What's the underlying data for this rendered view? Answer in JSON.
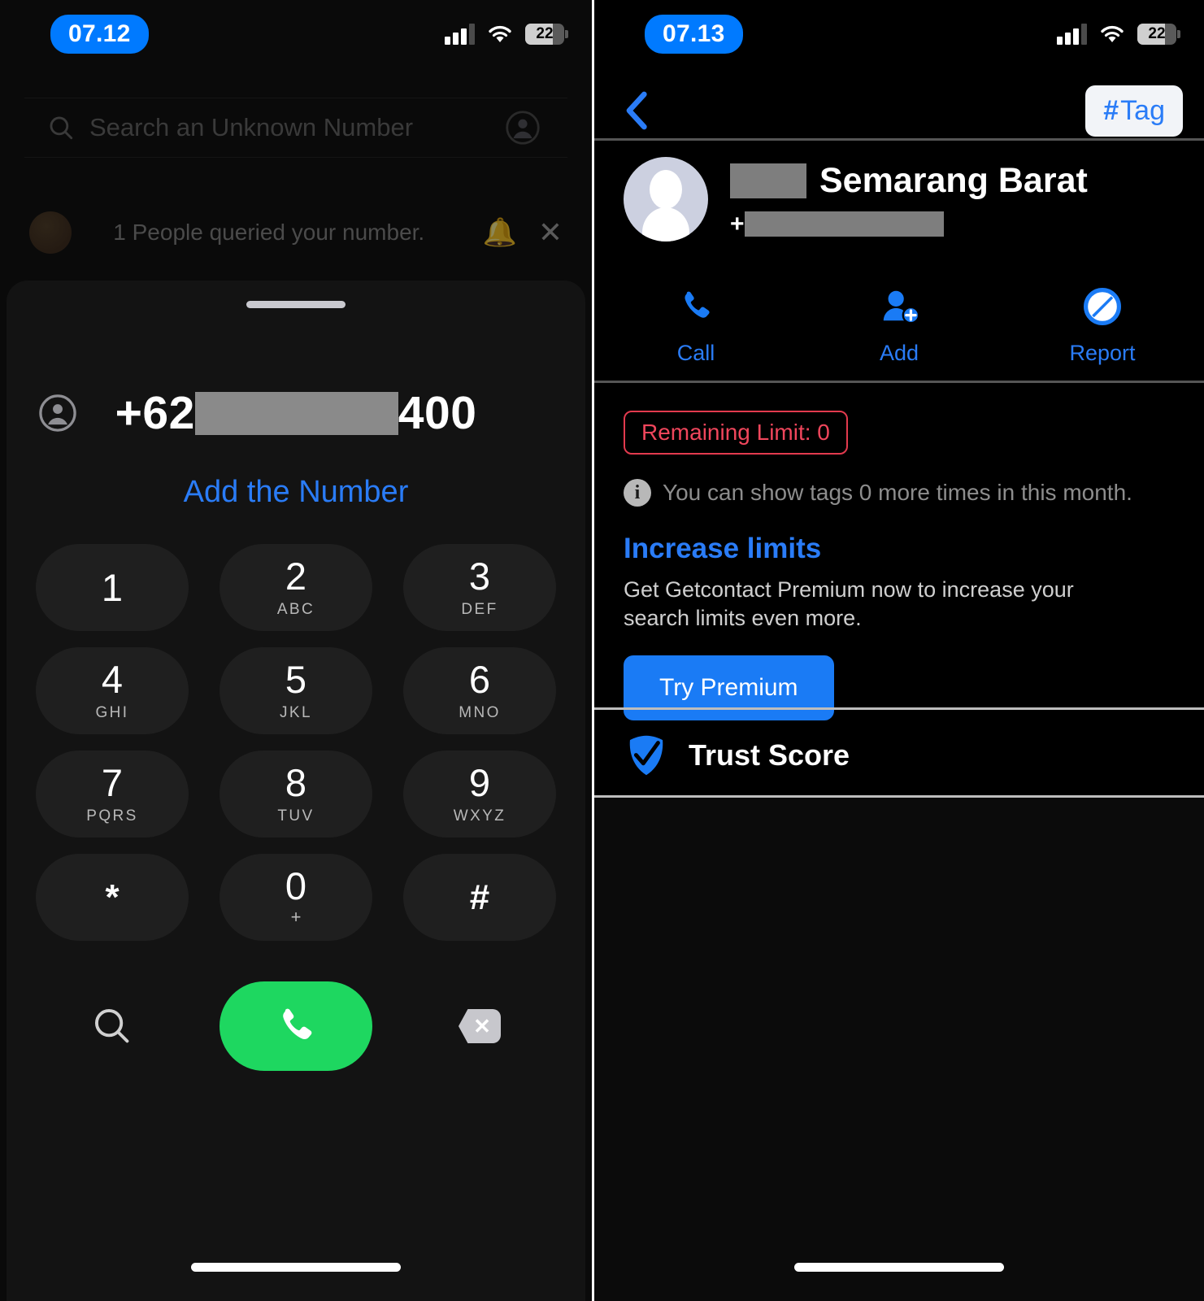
{
  "left": {
    "status": {
      "time": "07.12",
      "battery": "22",
      "signal_icon": "cellular-signal-icon",
      "wifi_icon": "wifi-icon",
      "battery_icon": "battery-icon"
    },
    "search": {
      "placeholder": "Search an Unknown Number",
      "icon": "search-icon",
      "profile_icon": "profile-avatar-icon"
    },
    "notification": {
      "text": "1 People queried your number.",
      "bell_icon": "bell-icon",
      "close_icon": "close-icon"
    },
    "dialer": {
      "country_code": "+62",
      "number_suffix": "400",
      "person_icon": "person-circle-icon",
      "add_number_label": "Add the Number",
      "keys": [
        {
          "digit": "1",
          "letters": ""
        },
        {
          "digit": "2",
          "letters": "ABC"
        },
        {
          "digit": "3",
          "letters": "DEF"
        },
        {
          "digit": "4",
          "letters": "GHI"
        },
        {
          "digit": "5",
          "letters": "JKL"
        },
        {
          "digit": "6",
          "letters": "MNO"
        },
        {
          "digit": "7",
          "letters": "PQRS"
        },
        {
          "digit": "8",
          "letters": "TUV"
        },
        {
          "digit": "9",
          "letters": "WXYZ"
        },
        {
          "digit": "*",
          "letters": ""
        },
        {
          "digit": "0",
          "letters": "+"
        },
        {
          "digit": "#",
          "letters": ""
        }
      ],
      "search_button_icon": "search-icon",
      "call_button_icon": "phone-handset-icon",
      "backspace_button_icon": "backspace-icon",
      "call_button_color": "#1ed760"
    }
  },
  "right": {
    "status": {
      "time": "07.13",
      "battery": "22",
      "signal_icon": "cellular-signal-icon",
      "wifi_icon": "wifi-icon",
      "battery_icon": "battery-icon"
    },
    "nav": {
      "back_icon": "back-chevron-icon",
      "tag_hash": "#",
      "tag_label": "Tag"
    },
    "contact": {
      "name": "Semarang Barat",
      "phone_prefix": "+",
      "avatar_icon": "person-avatar-icon"
    },
    "actions": [
      {
        "label": "Call",
        "icon": "phone-handset-icon"
      },
      {
        "label": "Add",
        "icon": "person-add-icon"
      },
      {
        "label": "Report",
        "icon": "block-report-icon"
      }
    ],
    "limit": {
      "pill": "Remaining Limit: 0",
      "pill_color": "#f0465c",
      "info_icon": "info-icon",
      "info_text": "You can show tags 0 more times in this month.",
      "increase_title": "Increase limits",
      "increase_desc": "Get Getcontact Premium now to increase your search limits even more.",
      "premium_button": "Try Premium",
      "premium_button_color": "#1a7bf5"
    },
    "trust": {
      "label": "Trust Score",
      "icon": "trust-check-badge-icon"
    }
  }
}
